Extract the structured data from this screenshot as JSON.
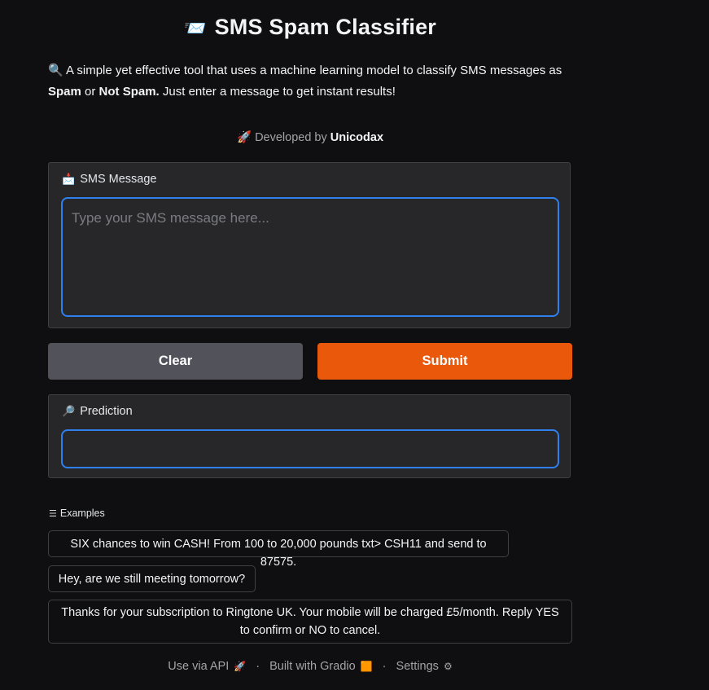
{
  "header": {
    "title_icon": "📨",
    "title": "SMS Spam Classifier"
  },
  "description": {
    "icon": "🔍",
    "text_1": "A simple yet effective tool that uses a machine learning model to classify SMS messages as",
    "bold_1": "Spam",
    "text_2": "or",
    "bold_2": "Not Spam.",
    "text_3": "Just enter a message to get instant results!"
  },
  "developer": {
    "icon": "🚀",
    "prefix": "Developed by",
    "name": "Unicodax"
  },
  "input": {
    "icon": "📩",
    "label": "SMS Message",
    "placeholder": "Type your SMS message here...",
    "value": ""
  },
  "buttons": {
    "clear_label": "Clear",
    "submit_label": "Submit"
  },
  "output": {
    "icon": "🔎",
    "label": "Prediction",
    "value": ""
  },
  "examples": {
    "header_icon": "☰",
    "header": "Examples",
    "items": [
      "SIX chances to win CASH! From 100 to 20,000 pounds txt> CSH11 and send to 87575.",
      "Hey, are we still meeting tomorrow?",
      "Thanks for your subscription to Ringtone UK. Your mobile will be charged £5/month. Reply YES to confirm or NO to cancel."
    ]
  },
  "footer": {
    "api_label": "Use via API",
    "api_icon": "🚀",
    "built_label": "Built with Gradio",
    "built_icon": "🟧",
    "settings_label": "Settings",
    "settings_icon": "⚙",
    "separator": "·"
  },
  "colors": {
    "background": "#0f0f11",
    "panel": "#27272a",
    "accent_border": "#2f80ed",
    "submit": "#ea580c",
    "clear": "#52525b"
  }
}
